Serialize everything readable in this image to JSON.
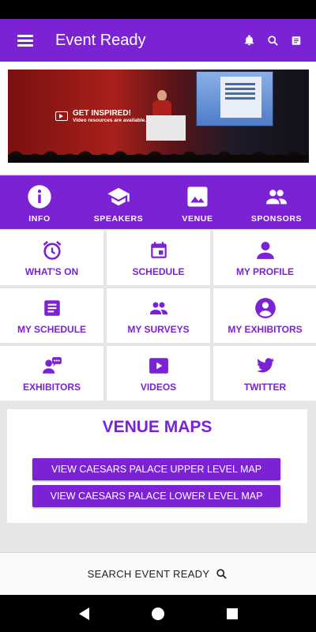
{
  "app_bar": {
    "title": "Event Ready",
    "actions": [
      "bell-icon",
      "search-icon",
      "notes-icon"
    ]
  },
  "banner": {
    "headline": "GET INSPIRED!",
    "subline": "Video resources are available."
  },
  "nav_strip": {
    "items": [
      {
        "label": "INFO",
        "icon": "info-icon"
      },
      {
        "label": "SPEAKERS",
        "icon": "graduation-cap-icon"
      },
      {
        "label": "VENUE",
        "icon": "image-icon"
      },
      {
        "label": "SPONSORS",
        "icon": "people-icon"
      }
    ]
  },
  "grid": {
    "tiles": [
      {
        "label": "WHAT'S ON",
        "icon": "alarm-clock-icon"
      },
      {
        "label": "SCHEDULE",
        "icon": "calendar-icon"
      },
      {
        "label": "MY PROFILE",
        "icon": "person-icon"
      },
      {
        "label": "MY SCHEDULE",
        "icon": "document-icon"
      },
      {
        "label": "MY SURVEYS",
        "icon": "group-icon"
      },
      {
        "label": "MY EXHIBITORS",
        "icon": "account-circle-icon"
      },
      {
        "label": "EXHIBITORS",
        "icon": "chat-people-icon"
      },
      {
        "label": "VIDEOS",
        "icon": "play-icon"
      },
      {
        "label": "TWITTER",
        "icon": "twitter-bird-icon"
      }
    ]
  },
  "venue_maps": {
    "title": "VENUE MAPS",
    "upper_button": "VIEW CAESARS PALACE UPPER LEVEL MAP",
    "lower_button": "VIEW CAESARS PALACE LOWER LEVEL MAP"
  },
  "search": {
    "label": "SEARCH EVENT READY"
  },
  "colors": {
    "accent": "#7b22d4",
    "tile_bg": "#ffffff",
    "page_bg": "#e6e6e6"
  }
}
